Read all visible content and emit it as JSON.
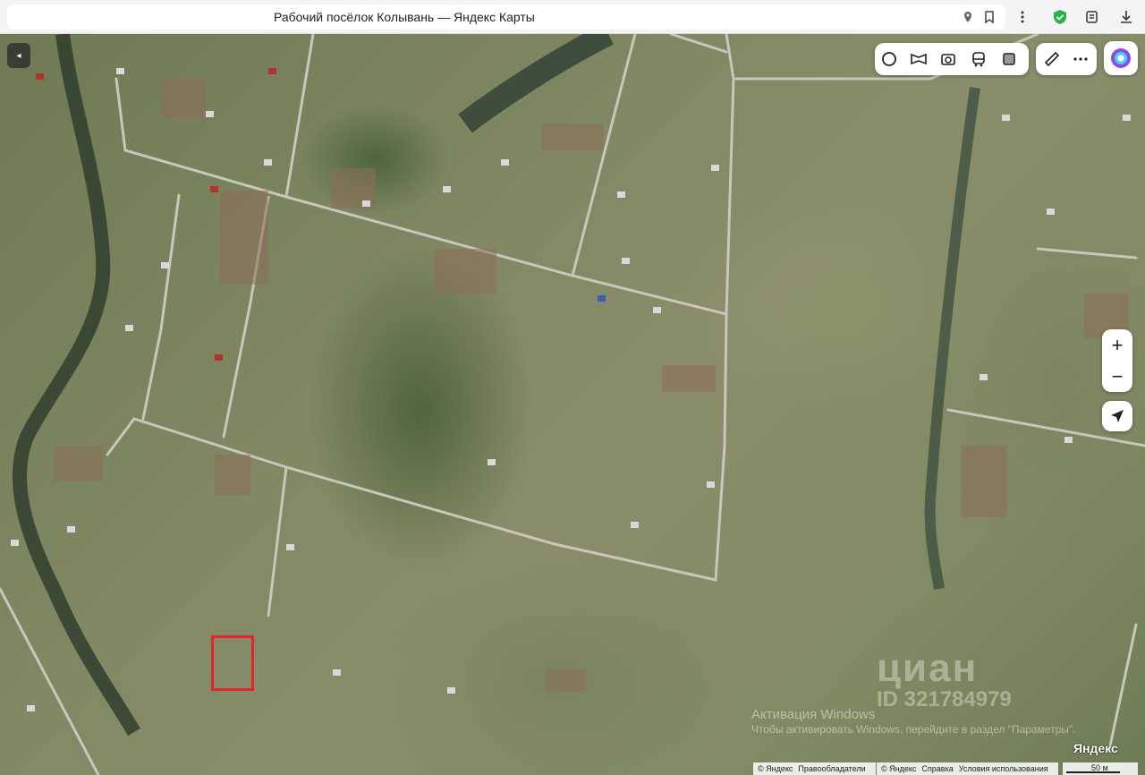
{
  "browser": {
    "page_title": "Рабочий посёлок Колывань — Яндекс Карты",
    "icons": [
      "location-pin-icon",
      "bookmark-icon",
      "menu-dots-icon",
      "shield-icon",
      "extensions-icon",
      "download-icon"
    ]
  },
  "map": {
    "collapse_label": "◂",
    "layers": [
      "traffic-icon",
      "panorama-icon",
      "camera-icon",
      "transit-icon",
      "layers-icon"
    ],
    "tools": [
      "ruler-icon",
      "more-icon"
    ],
    "zoom_in": "+",
    "zoom_out": "−",
    "watermark": "циан",
    "watermark_id": "ID 321784979",
    "windows_line1": "Активация Windows",
    "windows_line2": "Чтобы активировать Windows, перейдите в раздел \"Параметры\".",
    "logo": "Яндекс",
    "copyright_left": [
      "© Яндекс",
      "Правообладатели"
    ],
    "copyright_right": [
      "© Яндекс",
      "Справка",
      "Условия использования"
    ],
    "scale": "50 м"
  },
  "colors": {
    "marker": "#e3262b",
    "accent_green": "#2bb24c"
  }
}
